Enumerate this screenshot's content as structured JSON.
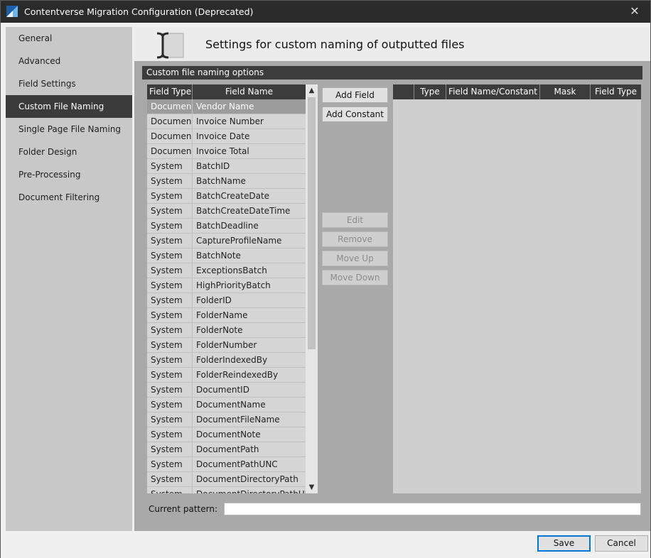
{
  "window": {
    "title": "Contentverse Migration Configuration (Deprecated)"
  },
  "sidebar": {
    "items": [
      {
        "label": "General",
        "active": false
      },
      {
        "label": "Advanced",
        "active": false
      },
      {
        "label": "Field Settings",
        "active": false
      },
      {
        "label": "Custom File Naming",
        "active": true
      },
      {
        "label": "Single Page File Naming",
        "active": false
      },
      {
        "label": "Folder Design",
        "active": false
      },
      {
        "label": "Pre-Processing",
        "active": false
      },
      {
        "label": "Document Filtering",
        "active": false
      }
    ]
  },
  "header": {
    "title": "Settings for custom naming of outputted files"
  },
  "section": {
    "title": "Custom file naming options"
  },
  "fields_table": {
    "columns": [
      "Field Type",
      "Field Name"
    ],
    "selected_index": 0,
    "rows": [
      [
        "Documen",
        "Vendor Name"
      ],
      [
        "Documen",
        "Invoice Number"
      ],
      [
        "Documen",
        "Invoice Date"
      ],
      [
        "Documen",
        "Invoice Total"
      ],
      [
        "System",
        "BatchID"
      ],
      [
        "System",
        "BatchName"
      ],
      [
        "System",
        "BatchCreateDate"
      ],
      [
        "System",
        "BatchCreateDateTime"
      ],
      [
        "System",
        "BatchDeadline"
      ],
      [
        "System",
        "CaptureProfileName"
      ],
      [
        "System",
        "BatchNote"
      ],
      [
        "System",
        "ExceptionsBatch"
      ],
      [
        "System",
        "HighPriorityBatch"
      ],
      [
        "System",
        "FolderID"
      ],
      [
        "System",
        "FolderName"
      ],
      [
        "System",
        "FolderNote"
      ],
      [
        "System",
        "FolderNumber"
      ],
      [
        "System",
        "FolderIndexedBy"
      ],
      [
        "System",
        "FolderReindexedBy"
      ],
      [
        "System",
        "DocumentID"
      ],
      [
        "System",
        "DocumentName"
      ],
      [
        "System",
        "DocumentFileName"
      ],
      [
        "System",
        "DocumentNote"
      ],
      [
        "System",
        "DocumentPath"
      ],
      [
        "System",
        "DocumentPathUNC"
      ],
      [
        "System",
        "DocumentDirectoryPath"
      ],
      [
        "System",
        "DocumentDirectoryPathUN"
      ]
    ]
  },
  "buttons": {
    "add_field": "Add Field",
    "add_constant": "Add Constant",
    "edit": "Edit",
    "remove": "Remove",
    "move_up": "Move Up",
    "move_down": "Move Down"
  },
  "pattern_table": {
    "columns": [
      "",
      "Type",
      "Field Name/Constant",
      "Mask",
      "Field Type"
    ]
  },
  "pattern": {
    "label": "Current pattern:",
    "value": ""
  },
  "dialog": {
    "save": "Save",
    "cancel": "Cancel"
  }
}
